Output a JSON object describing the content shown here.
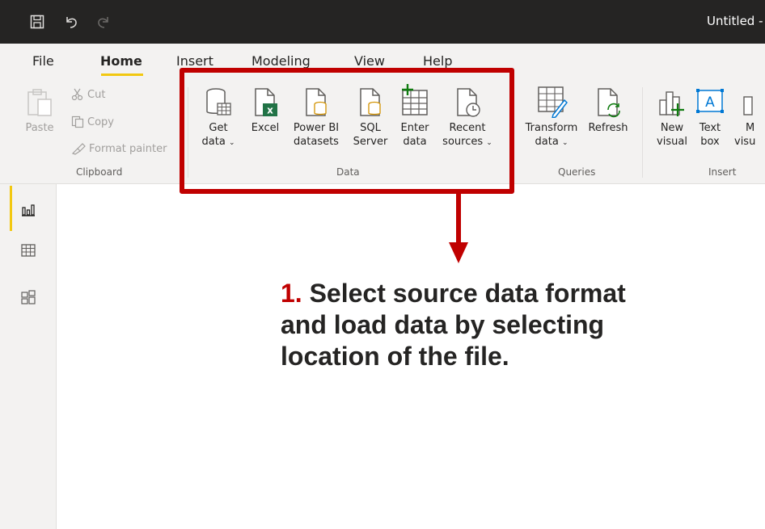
{
  "app": {
    "title": "Untitled -"
  },
  "titlebar_icons": [
    "save-icon",
    "undo-icon",
    "redo-icon"
  ],
  "tabs": [
    {
      "label": "File",
      "active": false
    },
    {
      "label": "Home",
      "active": true
    },
    {
      "label": "Insert",
      "active": false
    },
    {
      "label": "Modeling",
      "active": false
    },
    {
      "label": "View",
      "active": false
    },
    {
      "label": "Help",
      "active": false
    }
  ],
  "ribbon": {
    "clipboard": {
      "label": "Clipboard",
      "paste": "Paste",
      "cut": "Cut",
      "copy": "Copy",
      "format_painter": "Format painter"
    },
    "data": {
      "label": "Data",
      "get_data": {
        "line1": "Get",
        "line2": "data"
      },
      "excel": {
        "line1": "Excel"
      },
      "power_bi": {
        "line1": "Power BI",
        "line2": "datasets"
      },
      "sql": {
        "line1": "SQL",
        "line2": "Server"
      },
      "enter_data": {
        "line1": "Enter",
        "line2": "data"
      },
      "recent": {
        "line1": "Recent",
        "line2": "sources"
      }
    },
    "queries": {
      "label": "Queries",
      "transform": {
        "line1": "Transform",
        "line2": "data"
      },
      "refresh": {
        "line1": "Refresh"
      }
    },
    "insert": {
      "label": "Insert",
      "new_visual": {
        "line1": "New",
        "line2": "visual"
      },
      "text_box": {
        "line1": "Text",
        "line2": "box"
      },
      "more_visuals": {
        "line1": "M",
        "line2": "visu"
      }
    }
  },
  "rail_icons": [
    "report-view-icon",
    "data-view-icon",
    "model-view-icon"
  ],
  "callout": {
    "number": "1.",
    "text": " Select source data format and load data by selecting location of the file."
  },
  "colors": {
    "titlebar": "#252423",
    "ribbon": "#f3f2f1",
    "accent_yellow": "#f2c811",
    "highlight_red": "#c00000",
    "excel_green": "#217346"
  }
}
